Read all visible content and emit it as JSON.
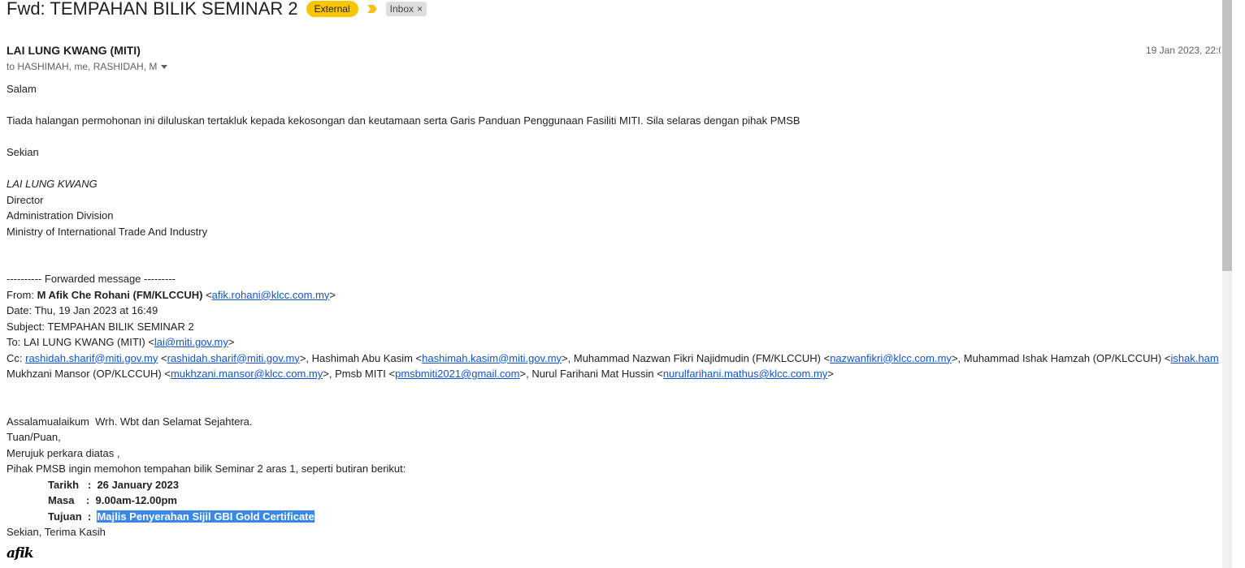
{
  "email": {
    "subject": "Fwd: TEMPAHAN BILIK SEMINAR 2",
    "external_label": "External",
    "importance_icon": "importance-marker-icon",
    "inbox_label": "Inbox",
    "inbox_remove": "×",
    "sender": "LAI LUNG KWANG (MITI)",
    "recipients": "to HASHIMAH, me, RASHIDAH, M",
    "date": "19 Jan 2023, 22:0"
  },
  "body": {
    "greeting": "Salam",
    "message": "Tiada halangan permohonan ini diluluskan tertakluk kepada kekosongan dan keutamaan serta Garis Panduan Penggunaan Fasiliti MITI. Sila selaras dengan pihak PMSB",
    "closing": "Sekian",
    "sig_name": "LAI LUNG KWANG",
    "sig_title": "Director",
    "sig_division": "Administration Division",
    "sig_ministry": "Ministry of International Trade And Industry"
  },
  "forwarded": {
    "header": "---------- Forwarded message ---------",
    "from_label": "From: ",
    "from_name": "M Afik Che Rohani (FM/KLCCUH)",
    "from_email": "afik.rohani@klcc.com.my",
    "date_line": "Date: Thu, 19 Jan 2023 at 16:49",
    "subject_line": "Subject: TEMPAHAN BILIK SEMINAR 2",
    "to_label": "To: LAI LUNG KWANG (MITI) <",
    "to_email": "lai@miti.gov.my",
    "cc_label": "Cc: ",
    "cc1_email": "rashidah.sharif@miti.gov.my",
    "cc1_email2": "rashidah.sharif@miti.gov.my",
    "cc2_name": "Hashimah Abu Kasim",
    "cc2_email": "hashimah.kasim@miti.gov.my",
    "cc3_name": "Muhammad Nazwan Fikri Najidmudin (FM/KLCCUH)",
    "cc3_email": "nazwanfikri@klcc.com.my",
    "cc4_name": "Muhammad Ishak Hamzah (OP/KLCCUH)",
    "cc4_email": "ishak.ham",
    "cc5_name": "Mukhzani Mansor (OP/KLCCUH)",
    "cc5_email": "mukhzani.mansor@klcc.com.my",
    "cc6_name": "Pmsb MITI",
    "cc6_email": "pmsbmiti2021@gmail.com",
    "cc7_name": "Nurul Farihani Mat Hussin",
    "cc7_email": "nurulfarihani.mathus@klcc.com.my"
  },
  "request": {
    "salutation": "Assalamualaikum  Wrh. Wbt dan Selamat Sejahtera.",
    "addressee": "Tuan/Puan,",
    "ref": "Merujuk perkara diatas ,",
    "intro": "Pihak PMSB ingin memohon tempahan bilik Seminar 2 aras 1, seperti butiran berikut:",
    "tarikh_label": "Tarikh   :",
    "tarikh_value": "26 January 2023",
    "masa_label": "Masa    :",
    "masa_value": "9.00am-12.00pm",
    "tujuan_label": "Tujuan  :",
    "tujuan_value": "Majlis Penyerahan Sijil GBI Gold Certificate",
    "thanks": "Sekian, Terima Kasih",
    "script_signature": "afik"
  }
}
